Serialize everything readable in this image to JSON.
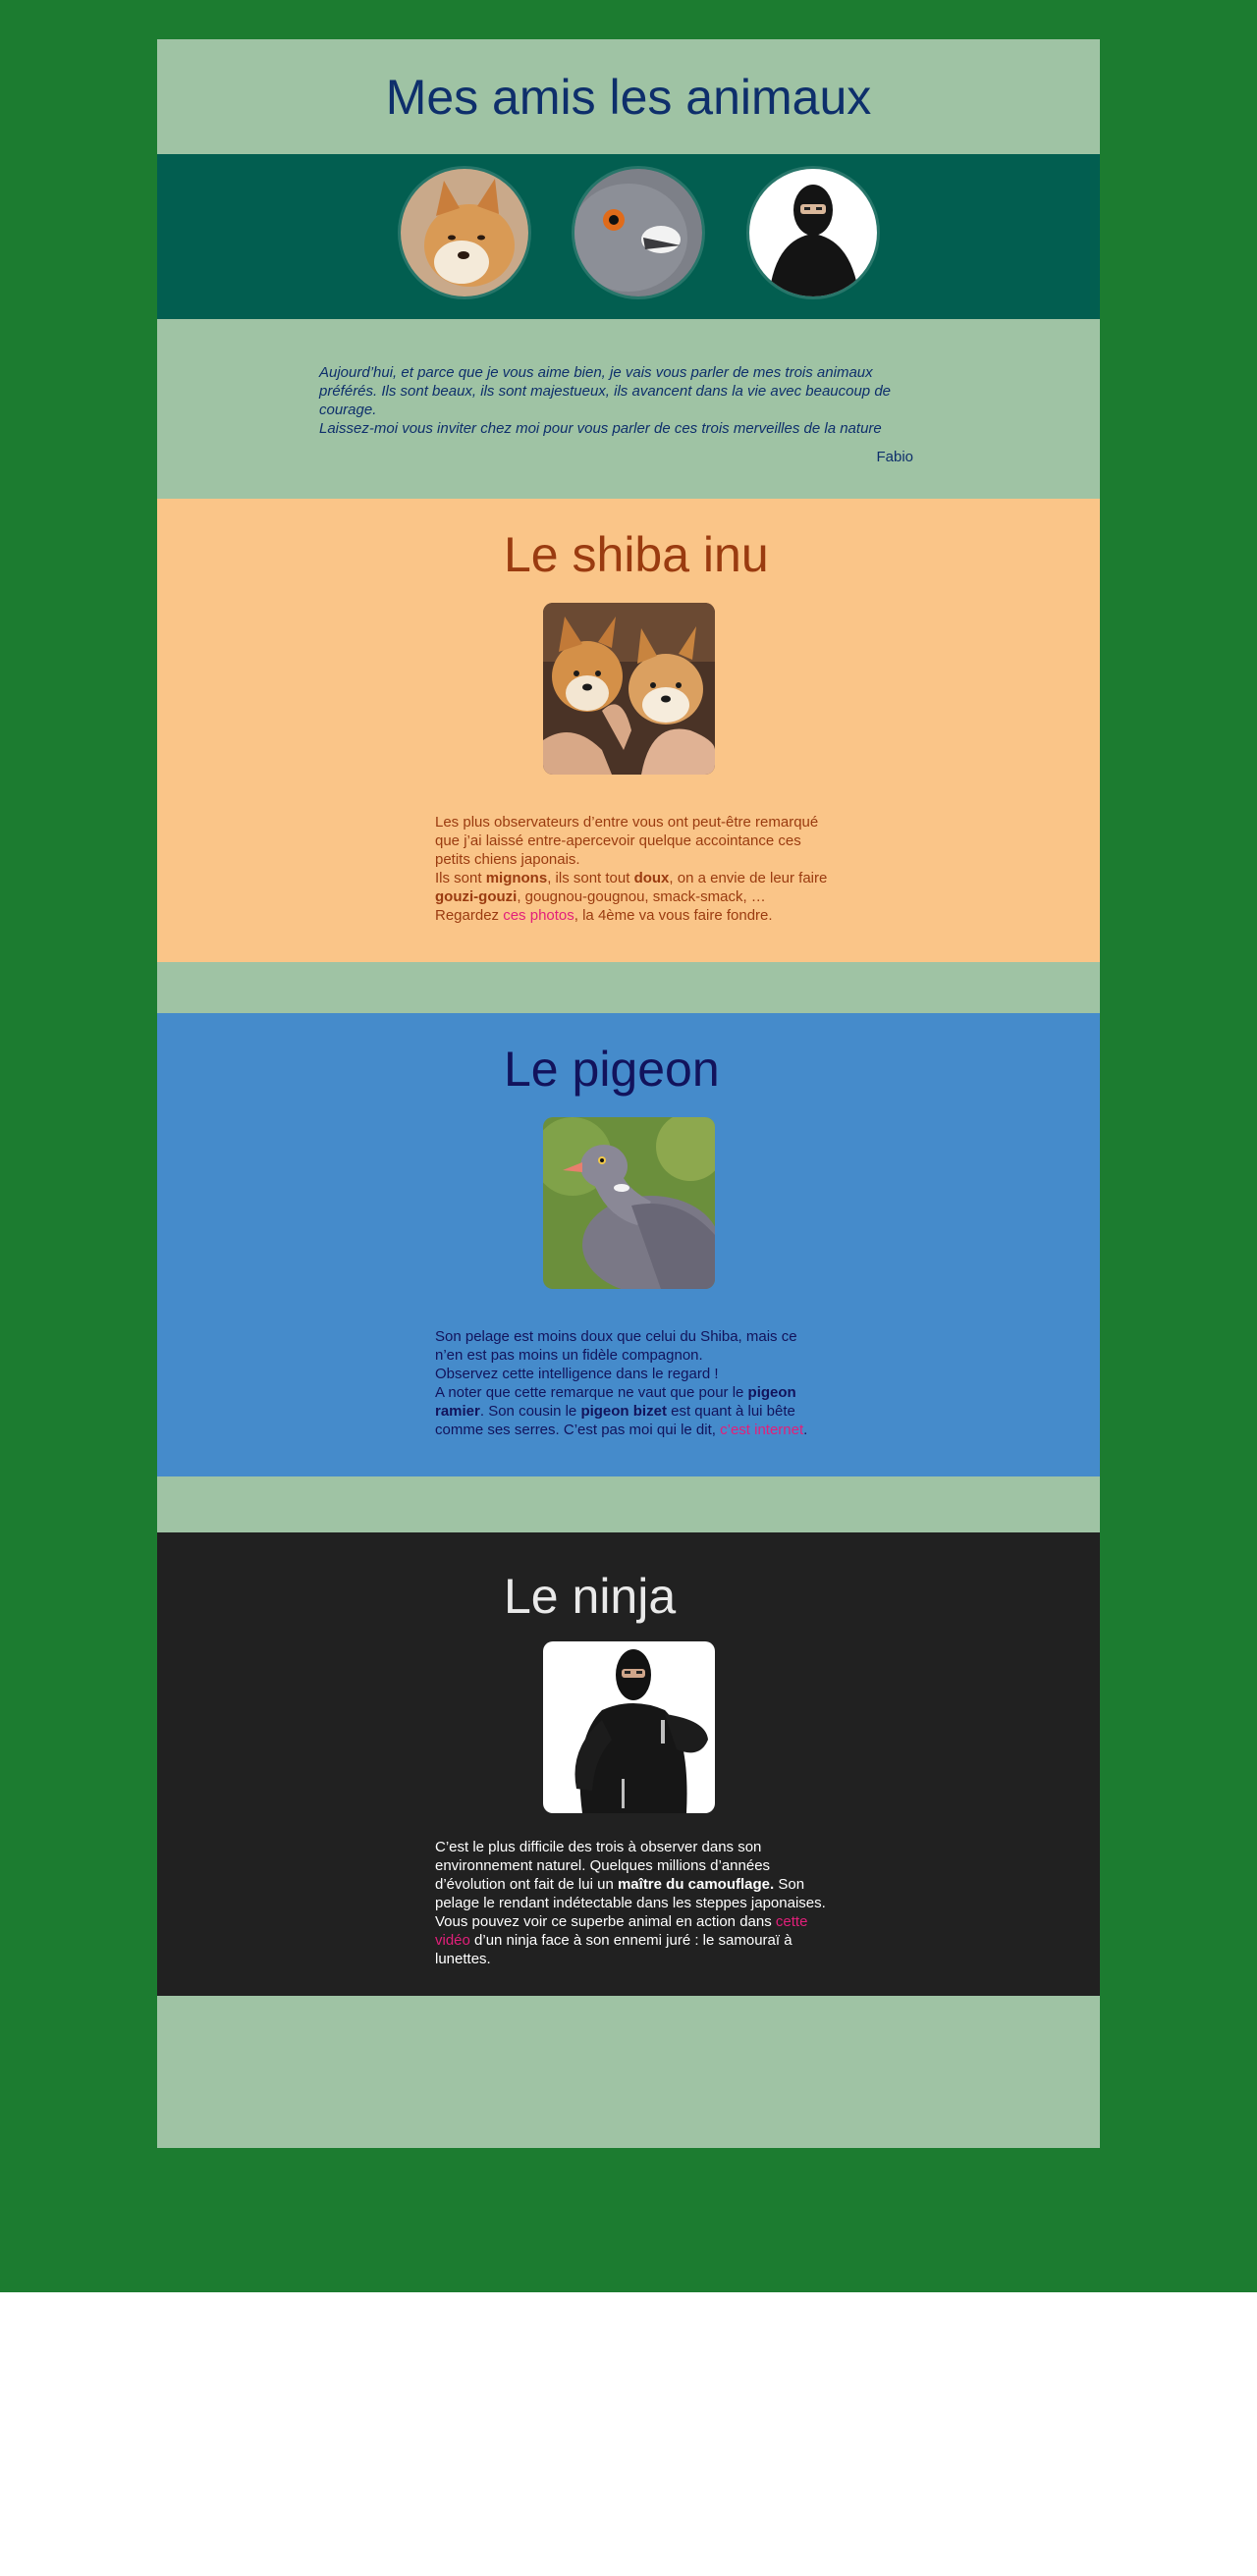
{
  "page": {
    "title": "Mes amis les animaux",
    "colors": {
      "page_background": "#1c7c30",
      "content_background": "#9fc3a4",
      "avatar_band": "#025e50",
      "title": "#0e2f6b",
      "link": "#e21f7a"
    }
  },
  "avatars": [
    {
      "icon": "shiba-avatar-icon"
    },
    {
      "icon": "pigeon-avatar-icon"
    },
    {
      "icon": "ninja-avatar-icon"
    }
  ],
  "intro": {
    "line1": "Aujourd’hui, et parce que je vous aime bien, je vais vous parler de mes trois animaux préférés. Ils sont beaux, ils sont majestueux, ils avancent dans la vie avec beaucoup de courage.",
    "line2": "Laissez-moi vous inviter chez moi pour vous parler de ces trois merveilles de la nature",
    "signature": "Fabio"
  },
  "shiba": {
    "title": "Le shiba inu",
    "color": "#9a3b10",
    "background": "#fac588",
    "p1": "Les plus observateurs d’entre vous ont peut-être remarqué que j’ai laissé entre-apercevoir quelque accointance ces petits chiens japonais.",
    "p2_a": "Ils sont ",
    "p2_b": "mignons",
    "p2_c": ", ils sont tout ",
    "p2_d": "doux",
    "p2_e": ", on a envie de leur faire ",
    "p2_f": "gouzi-gouzi",
    "p2_g": ", gougnou-gougnou, smack-smack, …",
    "p3_a": "Regardez ",
    "p3_link": "ces photos",
    "p3_b": ", la 4ème va vous faire fondre."
  },
  "pigeon": {
    "title": "Le pigeon",
    "color": "#12135c",
    "background": "#458bcb",
    "p1": "Son pelage est moins doux que celui du Shiba, mais ce n’en est pas moins un fidèle compagnon.",
    "p2": "Observez cette intelligence dans le regard !",
    "p3_a": "A noter que cette remarque ne vaut que pour le ",
    "p3_b": "pigeon ramier",
    "p3_c": ". Son cousin le ",
    "p3_d": "pigeon bizet",
    "p3_e": " est quant à lui bête comme ses serres. C’est pas moi qui le dit, ",
    "p3_link": "c’est internet",
    "p3_f": "."
  },
  "ninja": {
    "title": "Le ninja",
    "color": "#e9e9e9",
    "background": "#212121",
    "p1_a": "C’est le plus difficile des trois à observer dans son environnement naturel. Quelques millions d’années d’évolution ont fait de lui un ",
    "p1_b": "maître du camouflage.",
    "p1_c": " Son pelage le rendant indétectable dans les steppes japonaises.",
    "p2_a": "Vous pouvez voir ce superbe animal en action dans ",
    "p2_link": "cette vidéo",
    "p2_b": " d’un ninja face  à son ennemi juré : le samouraï à lunettes."
  }
}
